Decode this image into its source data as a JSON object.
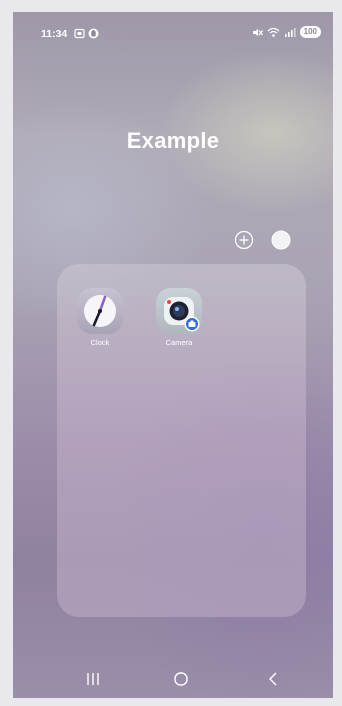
{
  "status_bar": {
    "time": "11:34",
    "battery": "100",
    "left_icons": [
      "gallery-notification-icon",
      "app-notification-icon"
    ],
    "right_icons": [
      "mute-icon",
      "wifi-icon",
      "signal-icon"
    ]
  },
  "folder": {
    "title": "Example",
    "controls": [
      "add-icon",
      "folder-color-icon"
    ],
    "apps": [
      {
        "label": "Clock",
        "icon": "clock-icon"
      },
      {
        "label": "Camera",
        "icon": "camera-icon"
      }
    ]
  },
  "nav_bar": {
    "buttons": [
      "recent-apps-icon",
      "home-icon",
      "back-icon"
    ]
  },
  "colors": {
    "folder_color_swatch": "#f2f2f4",
    "clock_hand": "#3a2b6e",
    "camera_badge": "#2d6fd6"
  }
}
